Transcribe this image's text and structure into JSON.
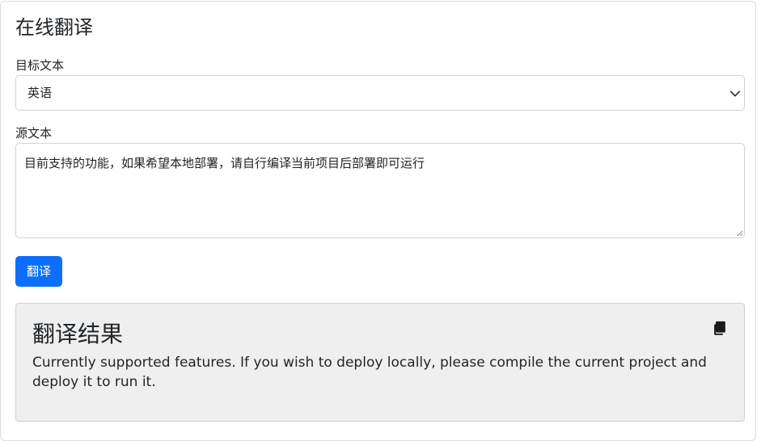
{
  "header": {
    "title": "在线翻译"
  },
  "target_language": {
    "label": "目标文本",
    "selected": "英语"
  },
  "source_text": {
    "label": "源文本",
    "value": "目前支持的功能，如果希望本地部署，请自行编译当前项目后部署即可运行"
  },
  "actions": {
    "translate_label": "翻译"
  },
  "result": {
    "title": "翻译结果",
    "text": "Currently supported features. If you wish to deploy locally, please compile the current project and deploy it to run it.",
    "copy_icon": "copy-icon"
  },
  "colors": {
    "primary": "#0d6efd",
    "result_background": "#efefef"
  }
}
